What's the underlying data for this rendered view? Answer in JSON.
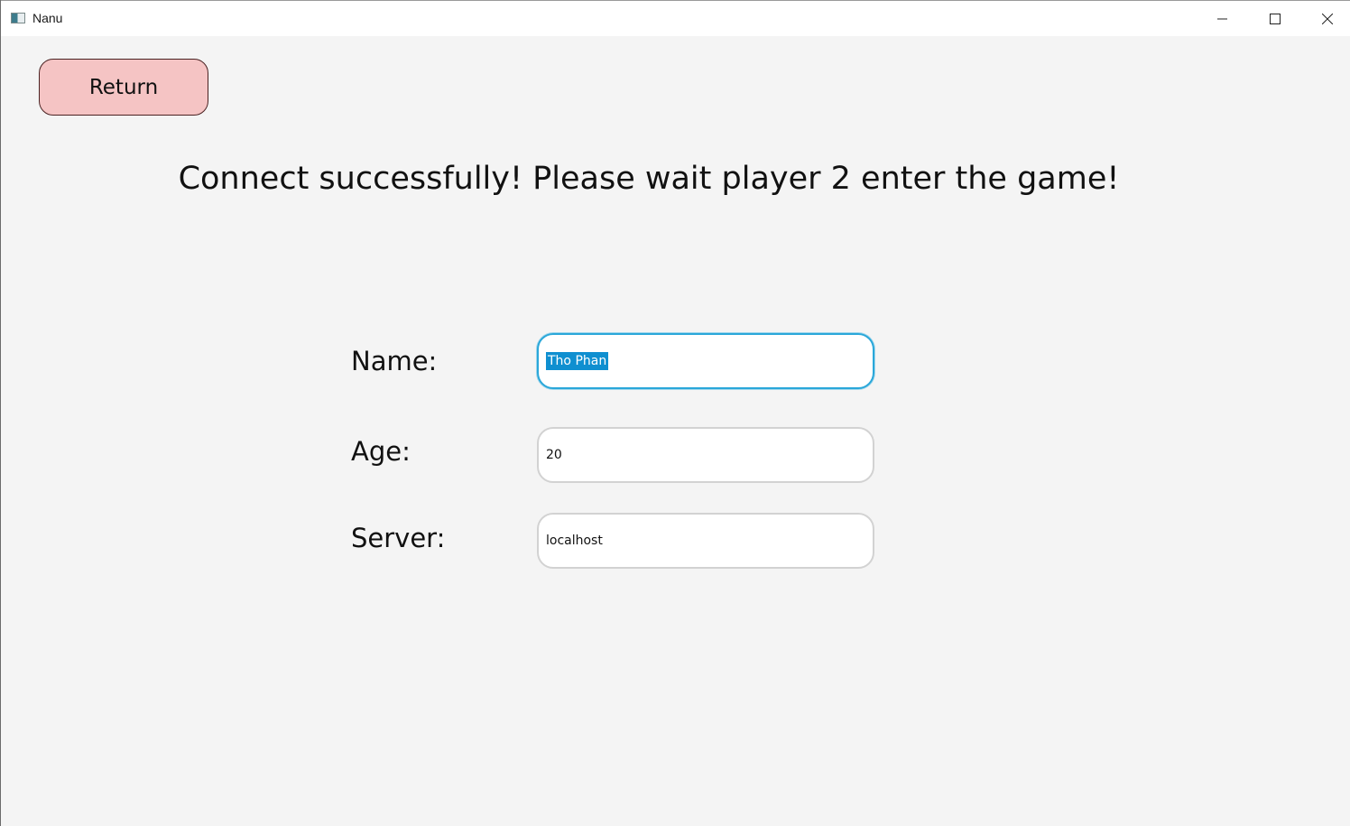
{
  "window": {
    "title": "Nanu",
    "icon": "java-app-icon",
    "controls": [
      "minimize-icon",
      "maximize-icon",
      "close-icon"
    ]
  },
  "return_button": {
    "label": "Return",
    "color": "#f5c4c4"
  },
  "status_message": "Connect successfully! Please wait player 2 enter the game!",
  "form": {
    "name": {
      "label": "Name:",
      "value": "Tho Phan",
      "focused": true,
      "selected": true
    },
    "age": {
      "label": "Age:",
      "value": "20"
    },
    "server": {
      "label": "Server:",
      "value": "localhost"
    }
  },
  "colors": {
    "background": "#f4f4f4",
    "focus_border": "#2aa7d9",
    "selection": "#0f8fd0"
  }
}
